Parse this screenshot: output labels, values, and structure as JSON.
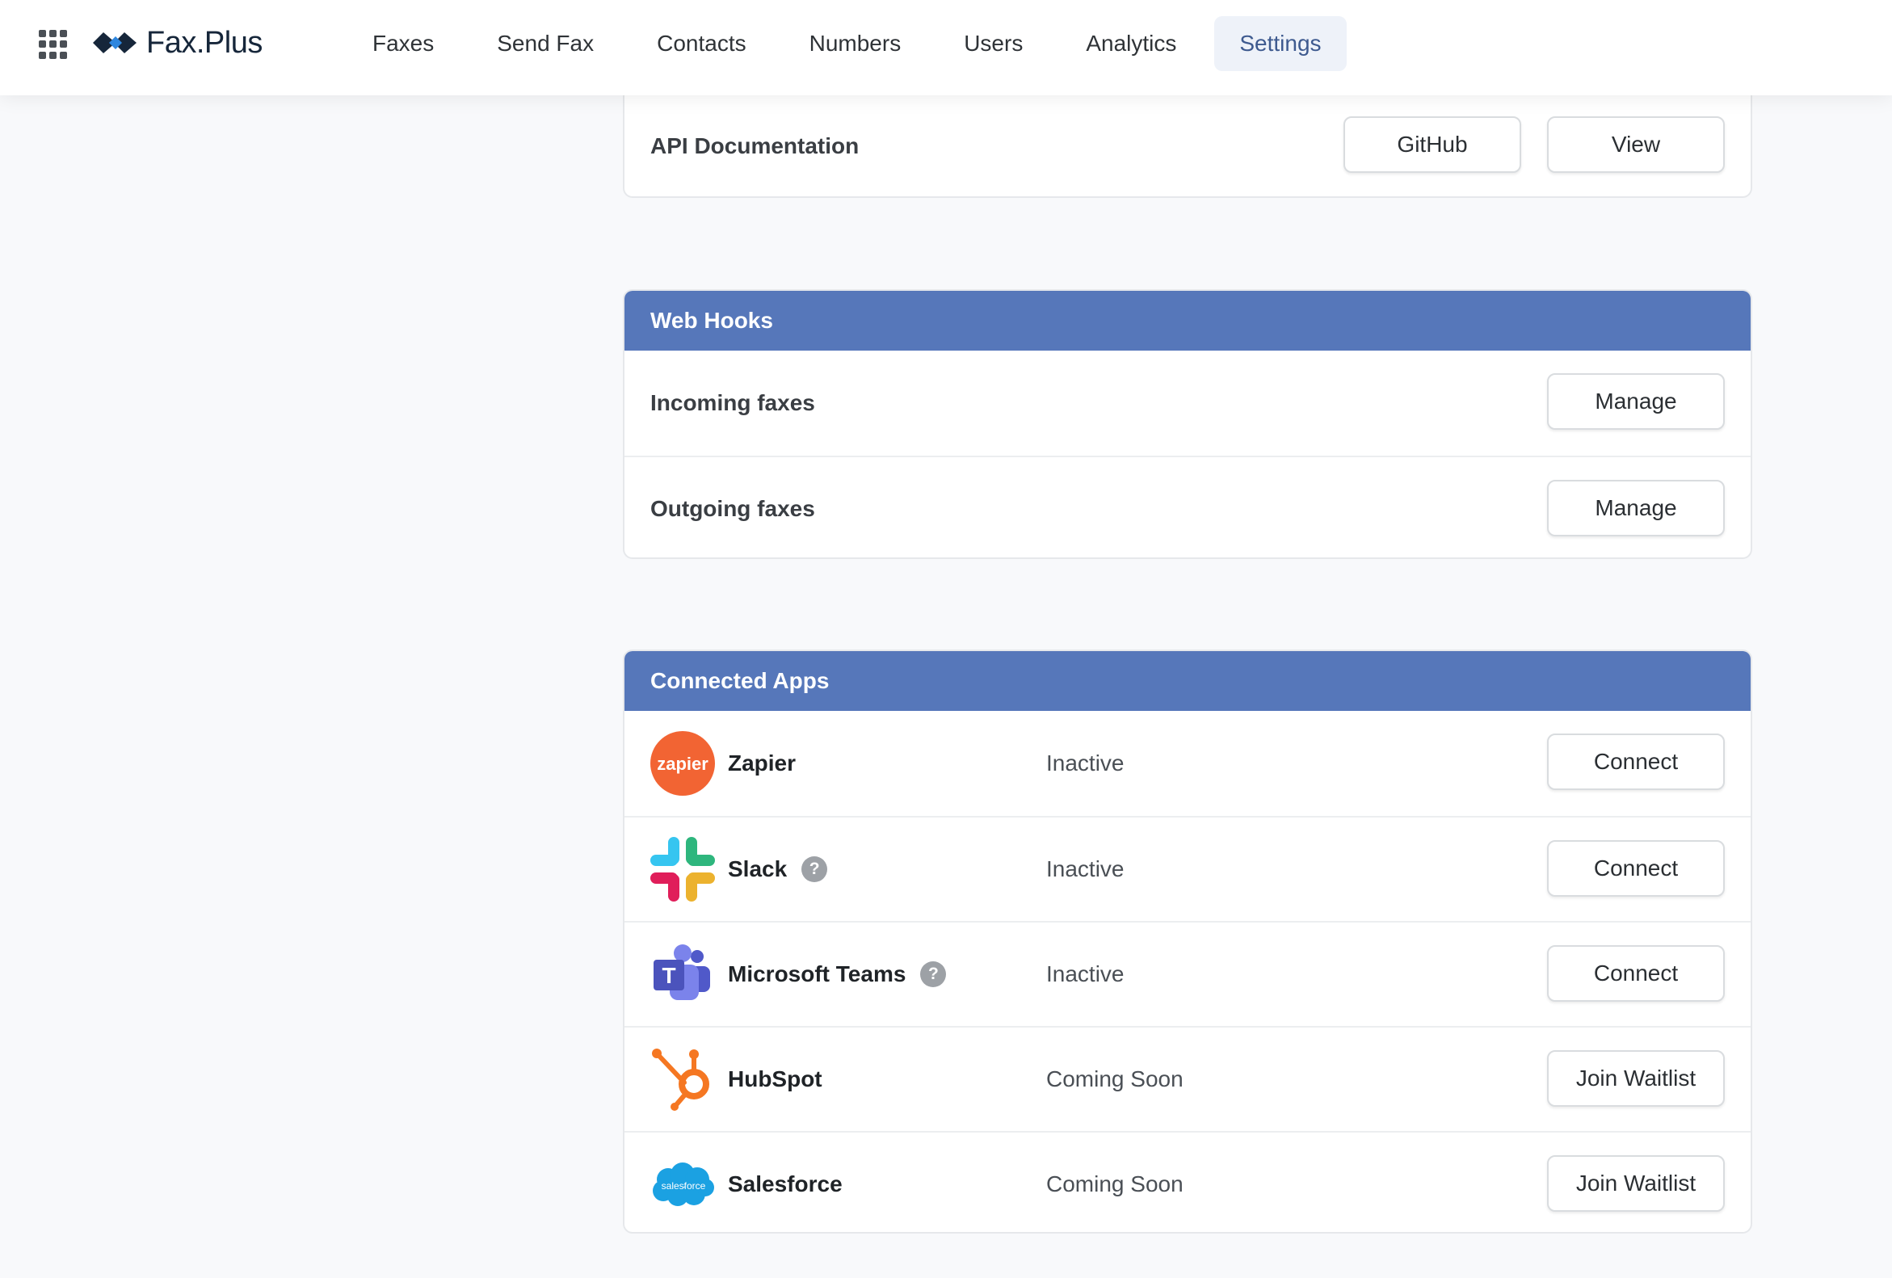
{
  "brand": {
    "name": "Fax.Plus"
  },
  "nav": {
    "items": [
      {
        "label": "Faxes",
        "active": false
      },
      {
        "label": "Send Fax",
        "active": false
      },
      {
        "label": "Contacts",
        "active": false
      },
      {
        "label": "Numbers",
        "active": false
      },
      {
        "label": "Users",
        "active": false
      },
      {
        "label": "Analytics",
        "active": false
      },
      {
        "label": "Settings",
        "active": true
      }
    ]
  },
  "api": {
    "label": "API Documentation",
    "github_button": "GitHub",
    "view_button": "View"
  },
  "webhooks": {
    "title": "Web Hooks",
    "rows": [
      {
        "label": "Incoming faxes",
        "button": "Manage"
      },
      {
        "label": "Outgoing faxes",
        "button": "Manage"
      }
    ]
  },
  "connected_apps": {
    "title": "Connected Apps",
    "apps": [
      {
        "name": "Zapier",
        "icon": "zapier-logo-icon",
        "status": "Inactive",
        "button": "Connect",
        "help": false
      },
      {
        "name": "Slack",
        "icon": "slack-logo-icon",
        "status": "Inactive",
        "button": "Connect",
        "help": true
      },
      {
        "name": "Microsoft Teams",
        "icon": "microsoft-teams-logo-icon",
        "status": "Inactive",
        "button": "Connect",
        "help": true
      },
      {
        "name": "HubSpot",
        "icon": "hubspot-logo-icon",
        "status": "Coming Soon",
        "button": "Join Waitlist",
        "help": false
      },
      {
        "name": "Salesforce",
        "icon": "salesforce-logo-icon",
        "status": "Coming Soon",
        "button": "Join Waitlist",
        "help": false
      }
    ],
    "logo_text": {
      "zapier": "zapier",
      "salesforce": "salesforce",
      "teams": "T"
    },
    "help_glyph": "?"
  },
  "colors": {
    "header_blue": "#5677ba",
    "active_nav_bg": "#eef2f9",
    "active_nav_text": "#3e5a8f",
    "zapier_orange": "#ff4f00",
    "hubspot_orange": "#f57722",
    "salesforce_blue": "#1798c1"
  }
}
